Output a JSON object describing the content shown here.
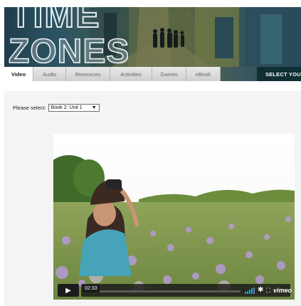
{
  "banner": {
    "logo_text_1": "TIME",
    "logo_text_2": "ZONES",
    "select_label": "SELECT YOU"
  },
  "tabs": [
    {
      "label": "Video",
      "active": true
    },
    {
      "label": "Audio",
      "active": false
    },
    {
      "label": "Resources",
      "active": false
    },
    {
      "label": "Activities",
      "active": false
    },
    {
      "label": "Games",
      "active": false
    },
    {
      "label": "eBook",
      "active": false
    }
  ],
  "selector": {
    "label": "Please select:",
    "value": "Book 2: Unit 1",
    "arrow": "▼"
  },
  "player": {
    "play_icon": "▶",
    "time": "02:33",
    "progress": 0.0,
    "brand": "vimeo",
    "settings_icon": "✱",
    "fullscreen_icon": "⛶",
    "accent": "#00adef"
  }
}
